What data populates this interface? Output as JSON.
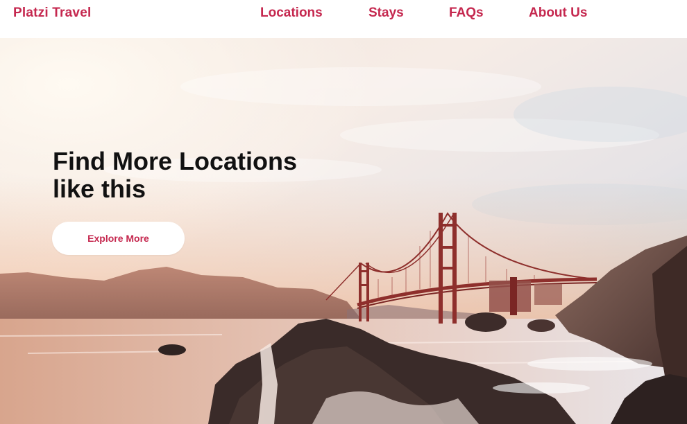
{
  "colors": {
    "accent": "#c5284f",
    "title": "#111111",
    "button_bg": "#ffffff"
  },
  "header": {
    "brand": "Platzi Travel",
    "nav": [
      {
        "label": "Locations"
      },
      {
        "label": "Stays"
      },
      {
        "label": "FAQs"
      },
      {
        "label": "About Us"
      }
    ]
  },
  "hero": {
    "title_line1": "Find More Locations",
    "title_line2": "like this",
    "cta_label": "Explore More",
    "image_subject": "golden-gate-bridge-sunset"
  }
}
